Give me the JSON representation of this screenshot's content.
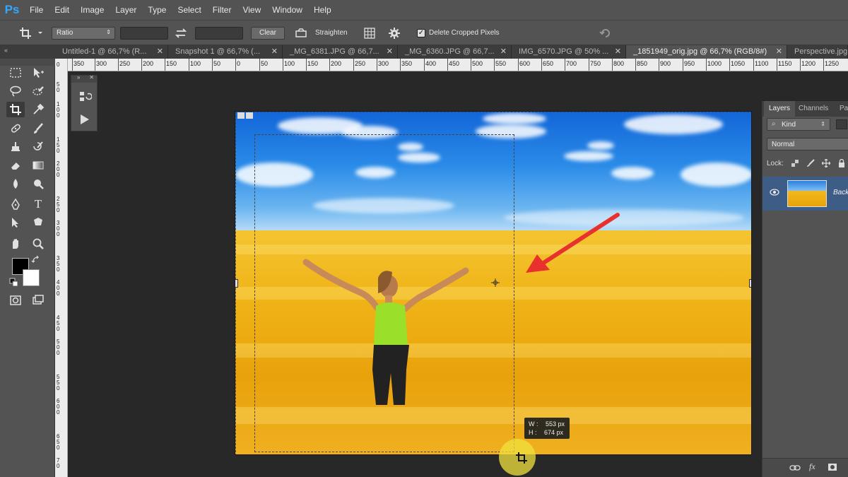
{
  "app": {
    "logo": "Ps"
  },
  "menu": [
    "File",
    "Edit",
    "Image",
    "Layer",
    "Type",
    "Select",
    "Filter",
    "View",
    "Window",
    "Help"
  ],
  "options": {
    "ratio_value": "Ratio",
    "clear_label": "Clear",
    "straighten_label": "Straighten",
    "delete_cropped_label": "Delete Cropped Pixels",
    "delete_cropped_checked": true
  },
  "tabs": [
    {
      "label": "Untitled-1 @ 66,7% (R..."
    },
    {
      "label": "Snapshot 1 @ 66,7% (..."
    },
    {
      "label": "_MG_6381.JPG @ 66,7..."
    },
    {
      "label": "_MG_6360.JPG @ 66,7..."
    },
    {
      "label": "IMG_6570.JPG @ 50% ..."
    },
    {
      "label": "_1851949_orig.jpg @ 66,7% (RGB/8#)"
    },
    {
      "label": "Perspective.jpg"
    }
  ],
  "ruler_h": [
    "350",
    "300",
    "250",
    "200",
    "150",
    "100",
    "50",
    "0",
    "50",
    "100",
    "150",
    "200",
    "250",
    "300",
    "350",
    "400",
    "450",
    "500",
    "550",
    "600",
    "650",
    "700",
    "750",
    "800",
    "850",
    "900",
    "950",
    "1000",
    "1050",
    "1100",
    "1150",
    "1200",
    "1250"
  ],
  "ruler_v": [
    "0",
    "5",
    "0",
    "1",
    "0",
    "0",
    "1",
    "5",
    "0",
    "2",
    "0",
    "0",
    "2",
    "5",
    "0",
    "3",
    "0",
    "0",
    "3",
    "5",
    "0",
    "4",
    "0",
    "0",
    "4",
    "5",
    "0",
    "5",
    "0",
    "0",
    "5",
    "5",
    "0",
    "6",
    "0",
    "0",
    "6",
    "5",
    "0",
    "7",
    "0"
  ],
  "crop_size": {
    "w_label": "W :",
    "w_value": "553 px",
    "h_label": "H :",
    "h_value": "674 px"
  },
  "panels": {
    "tabs": [
      "Layers",
      "Channels",
      "Pa"
    ],
    "kind_label": "Kind",
    "blend_mode": "Normal",
    "lock_label": "Lock:",
    "layer_name": "Back"
  },
  "colors": {
    "accent": "#31a8ff",
    "arrow": "#e8302c",
    "layer_selected": "#3d5c86"
  }
}
